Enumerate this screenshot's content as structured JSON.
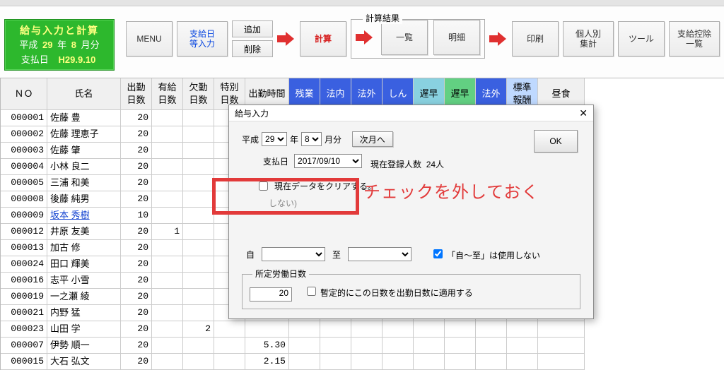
{
  "title_panel": {
    "line1": "給与入力と計算",
    "era": "平成",
    "year": "29",
    "year_suf": "年",
    "month": "8",
    "month_suf": "月分",
    "pay_label": "支払日",
    "pay_date": "H29.9.10"
  },
  "toolbar": {
    "menu": "MENU",
    "shikyu": "支給日\n等入力",
    "add": "追加",
    "del": "削除",
    "calc": "計算",
    "result_group": "計算結果",
    "list": "一覧",
    "detail": "明細",
    "print": "印刷",
    "personal": "個人別\n集計",
    "tool": "ツール",
    "deduct": "支給控除\n一覧"
  },
  "columns": [
    "ＮＯ",
    "氏名",
    "出勤\n日数",
    "有給\n日数",
    "欠勤\n日数",
    "特別\n日数",
    "出勤時間",
    "残業",
    "法内",
    "法外",
    "しん",
    "遅早",
    "遅早",
    "法外",
    "標準\n報酬",
    "昼食"
  ],
  "col_style": [
    "",
    "",
    "",
    "",
    "",
    "",
    "",
    "blue",
    "blue",
    "blue",
    "blue",
    "cyan",
    "grn",
    "blue",
    "lblue",
    ""
  ],
  "rows": [
    {
      "id": "000001",
      "name": "佐藤 豊",
      "c": [
        "20",
        "",
        "",
        "",
        "",
        "",
        "",
        "",
        "",
        "",
        "",
        "",
        "",
        ""
      ]
    },
    {
      "id": "000002",
      "name": "佐藤 理恵子",
      "c": [
        "20",
        "",
        "",
        "",
        "",
        "",
        "",
        "",
        "",
        "",
        "",
        "",
        "",
        ""
      ]
    },
    {
      "id": "000003",
      "name": "佐藤 肇",
      "c": [
        "20",
        "",
        "",
        "",
        "",
        "",
        "",
        "",
        "",
        "",
        "",
        "",
        "",
        ""
      ]
    },
    {
      "id": "000004",
      "name": "小林 良二",
      "c": [
        "20",
        "",
        "",
        "",
        "",
        "",
        "",
        "",
        "",
        "",
        "",
        "",
        "",
        ""
      ]
    },
    {
      "id": "000005",
      "name": "三浦 和美",
      "c": [
        "20",
        "",
        "",
        "",
        "",
        "",
        "",
        "",
        "",
        "",
        "",
        "",
        "",
        ""
      ]
    },
    {
      "id": "000008",
      "name": "後藤 純男",
      "c": [
        "20",
        "",
        "",
        "",
        "",
        "",
        "",
        "",
        "",
        "",
        "",
        "",
        "",
        ""
      ]
    },
    {
      "id": "000009",
      "name": "坂本 秀樹",
      "link": true,
      "c": [
        "10",
        "",
        "",
        "",
        "",
        "",
        "",
        "",
        "",
        "",
        "",
        "",
        "",
        ""
      ]
    },
    {
      "id": "000012",
      "name": "井原 友美",
      "c": [
        "20",
        "1",
        "",
        "",
        "",
        "",
        "",
        "",
        "",
        "",
        "",
        "",
        "",
        ""
      ]
    },
    {
      "id": "000013",
      "name": "加古 修",
      "c": [
        "20",
        "",
        "",
        "",
        "",
        "",
        "",
        "",
        "",
        "",
        "",
        "",
        "",
        ""
      ]
    },
    {
      "id": "000024",
      "name": "田口 輝美",
      "c": [
        "20",
        "",
        "",
        "",
        "",
        "",
        "",
        "",
        "",
        "",
        "",
        "",
        "",
        ""
      ]
    },
    {
      "id": "000016",
      "name": "志平 小雪",
      "c": [
        "20",
        "",
        "",
        "",
        "",
        "",
        "",
        "",
        "",
        "",
        "",
        "",
        "",
        ""
      ]
    },
    {
      "id": "000019",
      "name": "一之瀬 綾",
      "c": [
        "20",
        "",
        "",
        "",
        "",
        "",
        "",
        "",
        "",
        "",
        "",
        "",
        "",
        ""
      ]
    },
    {
      "id": "000021",
      "name": "内野 猛",
      "c": [
        "20",
        "",
        "",
        "",
        "",
        "",
        "",
        "",
        "",
        "",
        "",
        "",
        "",
        ""
      ]
    },
    {
      "id": "000023",
      "name": "山田 学",
      "c": [
        "20",
        "",
        "2",
        "",
        "",
        "",
        "",
        "",
        "",
        "",
        "",
        "",
        "",
        ""
      ]
    },
    {
      "id": "000007",
      "name": "伊勢 順一",
      "c": [
        "20",
        "",
        "",
        "",
        "5.30",
        "",
        "",
        "",
        "",
        "",
        "",
        "",
        "",
        ""
      ]
    },
    {
      "id": "000015",
      "name": "大石 弘文",
      "c": [
        "20",
        "",
        "",
        "",
        "2.15",
        "",
        "",
        "",
        "",
        "",
        "",
        "",
        "",
        ""
      ]
    }
  ],
  "dialog": {
    "title": "給与入力",
    "era": "平成",
    "year": "29",
    "year_suf": "年",
    "month": "8",
    "month_suf": "月分",
    "next_month": "次月へ",
    "ok": "OK",
    "pay_label": "支払日",
    "pay_date": "2017/09/10",
    "reg_label": "現在登録人数",
    "reg_count": "24人",
    "clear_chk": "現在データをクリアする。",
    "clear_sub": "しない)",
    "from": "自",
    "to": "至",
    "donot_use": "「自～至」は使用しない",
    "fieldset_label": "所定労働日数",
    "working_days": "20",
    "apply_chk": "暫定的にこの日数を出勤日数に適用する"
  },
  "callout": "チェックを外しておく"
}
